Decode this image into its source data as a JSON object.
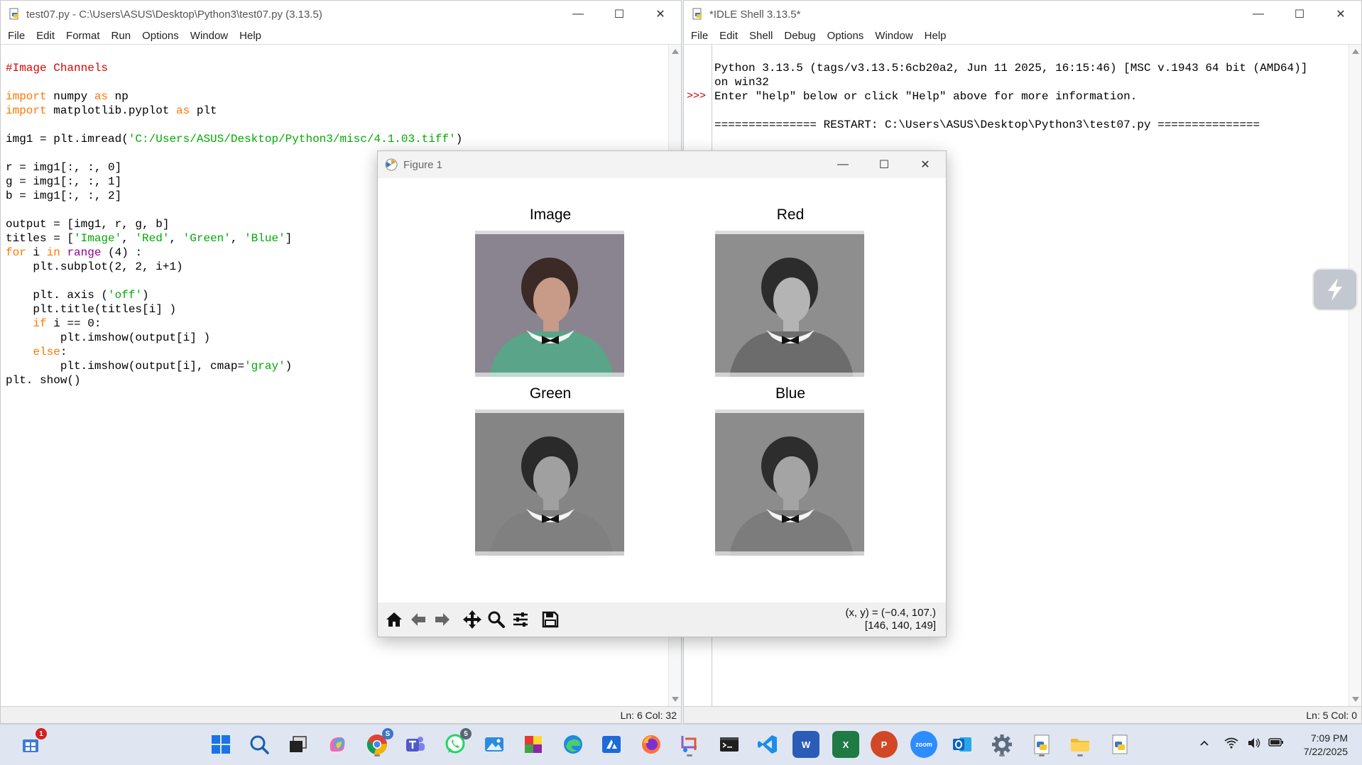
{
  "editor": {
    "title": "test07.py - C:\\Users\\ASUS\\Desktop\\Python3\\test07.py (3.13.5)",
    "menu": [
      "File",
      "Edit",
      "Format",
      "Run",
      "Options",
      "Window",
      "Help"
    ],
    "status": "Ln: 6   Col: 32",
    "lines": [
      "#Image Channels",
      "",
      "import numpy as np",
      "import matplotlib.pyplot as plt",
      "",
      "img1 = plt.imread('C:/Users/ASUS/Desktop/Python3/misc/4.1.03.tiff')",
      "",
      "r = img1[:, :, 0]",
      "g = img1[:, :, 1]",
      "b = img1[:, :, 2]",
      "",
      "output = [img1, r, g, b]",
      "titles = ['Image', 'Red', 'Green', 'Blue']",
      "for i in range (4) :",
      "    plt.subplot(2, 2, i+1)",
      "",
      "    plt. axis ('off')",
      "    plt.title(titles[i] )",
      "    if i == 0:",
      "        plt.imshow(output[i] )",
      "    else:",
      "        plt.imshow(output[i], cmap='gray')",
      "plt. show()"
    ]
  },
  "shell": {
    "title": "*IDLE Shell 3.13.5*",
    "menu": [
      "File",
      "Edit",
      "Shell",
      "Debug",
      "Options",
      "Window",
      "Help"
    ],
    "status": "Ln: 5   Col: 0",
    "prompt": ">>>",
    "lines": [
      "Python 3.13.5 (tags/v3.13.5:6cb20a2, Jun 11 2025, 16:15:46) [MSC v.1943 64 bit (AMD64)]",
      "on win32",
      "Enter \"help\" below or click \"Help\" above for more information.",
      "",
      "=============== RESTART: C:\\Users\\ASUS\\Desktop\\Python3\\test07.py ==============="
    ]
  },
  "figure": {
    "title": "Figure 1",
    "subplots": [
      "Image",
      "Red",
      "Green",
      "Blue"
    ],
    "coords_line1": "(x, y) = (−0.4, 107.)",
    "coords_line2": "[146, 140, 149]",
    "toolbar": [
      "home-icon",
      "back-icon",
      "forward-icon",
      "pan-icon",
      "zoom-icon",
      "configure-icon",
      "save-icon"
    ]
  },
  "taskbar": {
    "time": "7:09 PM",
    "date": "7/22/2025",
    "badge_store": "1",
    "badge_chrome": "S",
    "badge_whatsapp": "5",
    "zoom_label": "zoom",
    "word_label": "W",
    "excel_label": "X",
    "ppt_label": "P"
  }
}
